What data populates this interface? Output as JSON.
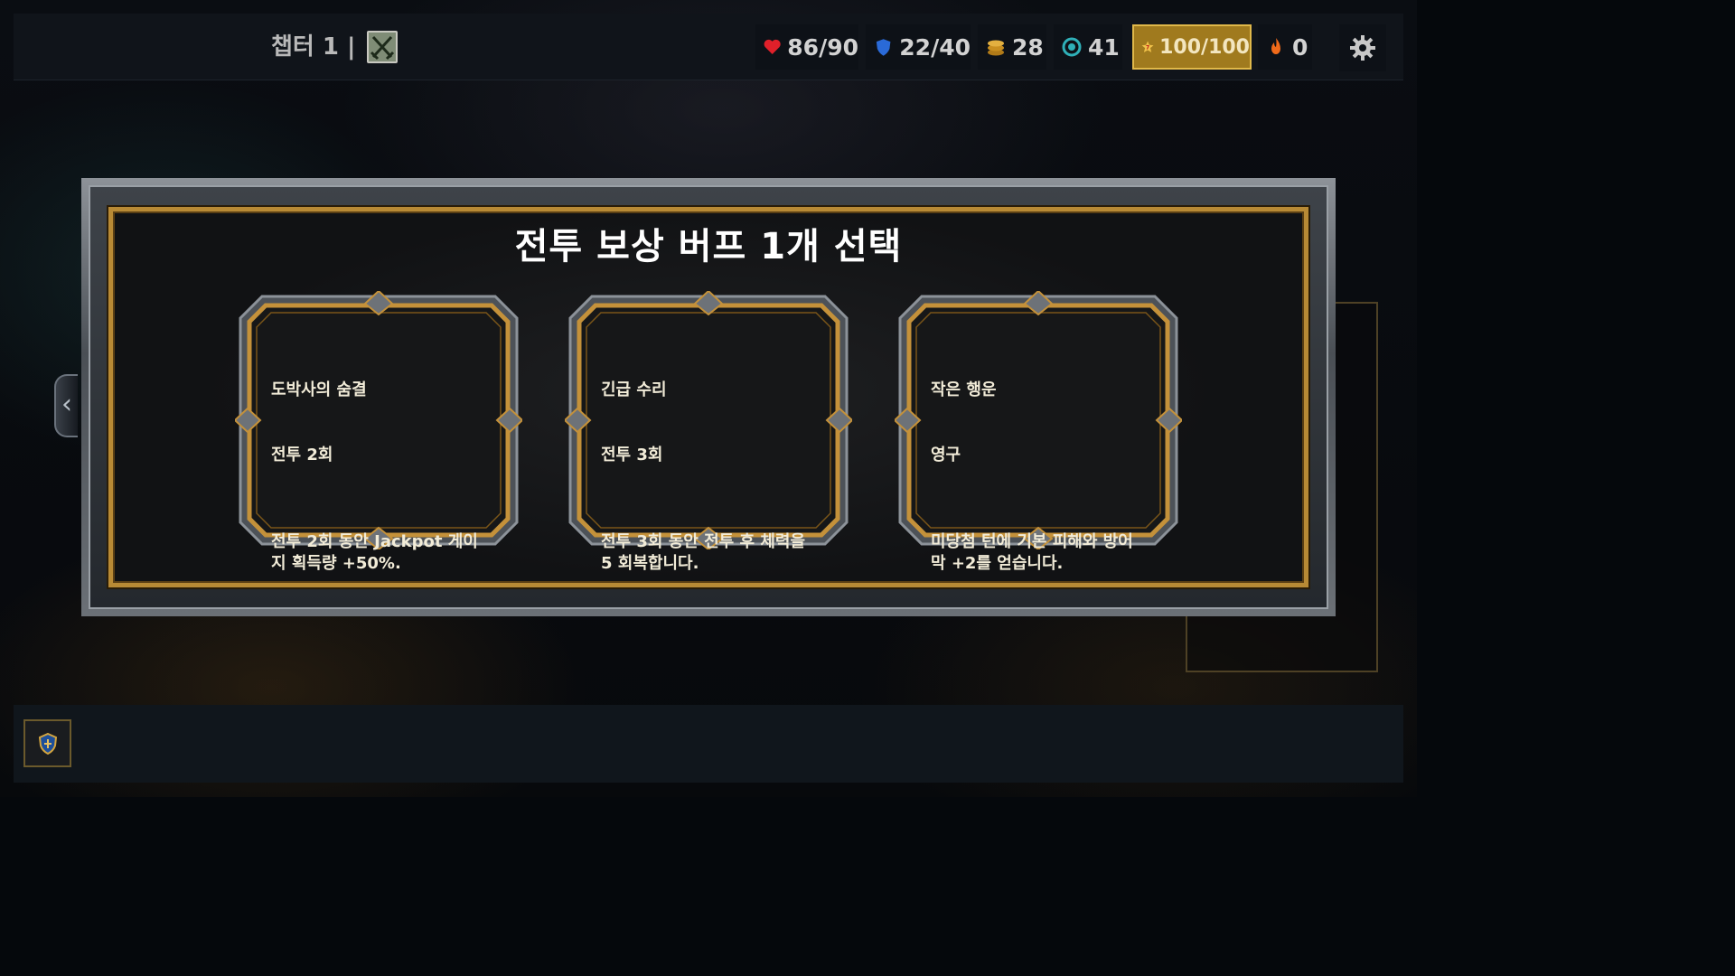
{
  "header": {
    "chapter_label": "챕터 1 |",
    "chapter_icon": "crossed-swords-icon",
    "stats": [
      {
        "id": "hp",
        "icon": "heart-icon",
        "value": "86/90",
        "color": "#e0202a"
      },
      {
        "id": "shield",
        "icon": "shield-icon",
        "value": "22/40",
        "color": "#2a6ad8"
      },
      {
        "id": "gold",
        "icon": "coin-stack-icon",
        "value": "28",
        "color": "#d9a530"
      },
      {
        "id": "chips",
        "icon": "chip-icon",
        "value": "41",
        "color": "#2fb0b8"
      },
      {
        "id": "jackpot",
        "icon": "slot-seven-icon",
        "value": "100/100",
        "color": "#e0b84a"
      },
      {
        "id": "fire",
        "icon": "flame-icon",
        "value": "0",
        "color": "#f06a1a"
      }
    ],
    "settings_icon": "gear-icon"
  },
  "modal": {
    "title": "전투 보상 버프 1개 선택",
    "cards": [
      {
        "name": "도박사의 숨결",
        "duration": "전투 2회",
        "description": "전투 2회 동안 Jackpot 게이지 획득량 +50%."
      },
      {
        "name": "긴급 수리",
        "duration": "전투 3회",
        "description": "전투 3회 동안 전투 후 체력을 5 회복합니다."
      },
      {
        "name": "작은 행운",
        "duration": "영구",
        "description": "미당첨 턴에 기본 피해와 방어막 +2를 얻습니다."
      }
    ]
  },
  "footer": {
    "slot_icon": "shield-potion-icon"
  }
}
